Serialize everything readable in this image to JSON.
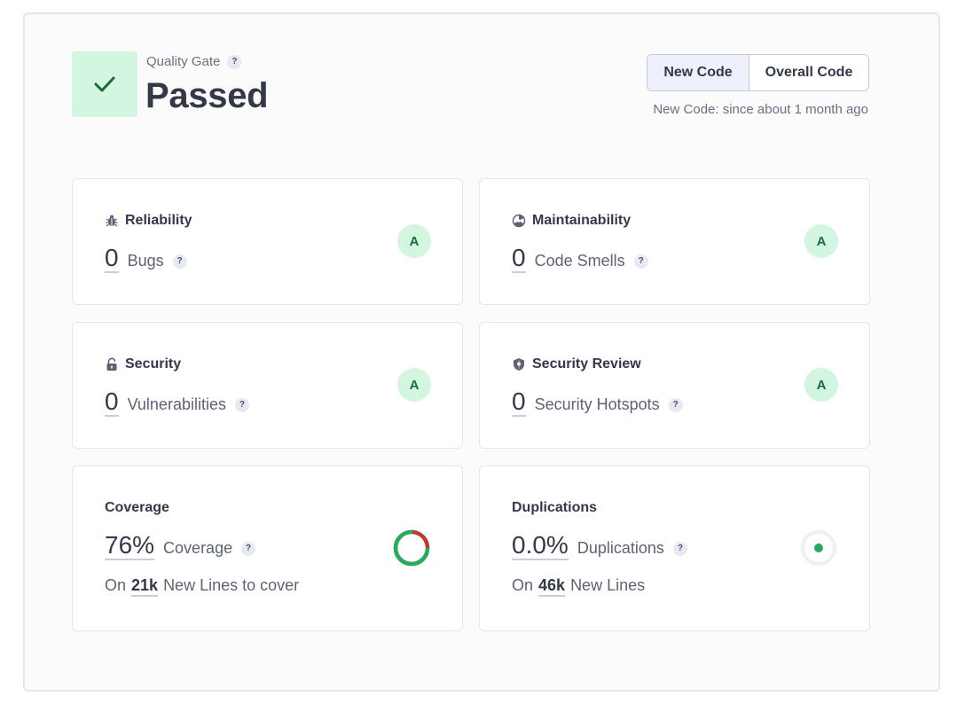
{
  "quality_gate": {
    "label": "Quality Gate",
    "status": "Passed",
    "help": "?"
  },
  "toggle": {
    "new_code": "New Code",
    "overall_code": "Overall Code",
    "selected": "New Code"
  },
  "new_code_since": "New Code: since about 1 month ago",
  "cards": {
    "reliability": {
      "title": "Reliability",
      "value": "0",
      "label": "Bugs",
      "rating": "A",
      "icon": "bug-icon"
    },
    "maintainability": {
      "title": "Maintainability",
      "value": "0",
      "label": "Code Smells",
      "rating": "A",
      "icon": "smell-icon"
    },
    "security": {
      "title": "Security",
      "value": "0",
      "label": "Vulnerabilities",
      "rating": "A",
      "icon": "lock-icon"
    },
    "security_review": {
      "title": "Security Review",
      "value": "0",
      "label": "Security Hotspots",
      "rating": "A",
      "icon": "shield-icon"
    },
    "coverage": {
      "title": "Coverage",
      "value": "76%",
      "label": "Coverage",
      "sub_prefix": "On",
      "sub_value": "21k",
      "sub_suffix": "New Lines to cover",
      "percent": 76
    },
    "duplications": {
      "title": "Duplications",
      "value": "0.0%",
      "label": "Duplications",
      "sub_prefix": "On",
      "sub_value": "46k",
      "sub_suffix": "New Lines",
      "percent": 0.0
    }
  },
  "colors": {
    "rating_bg": "#d2f6df",
    "rating_text": "#1c6b3a",
    "coverage_good": "#1fae5b",
    "coverage_bad": "#c0392b",
    "dup_dot": "#1fae5b"
  }
}
